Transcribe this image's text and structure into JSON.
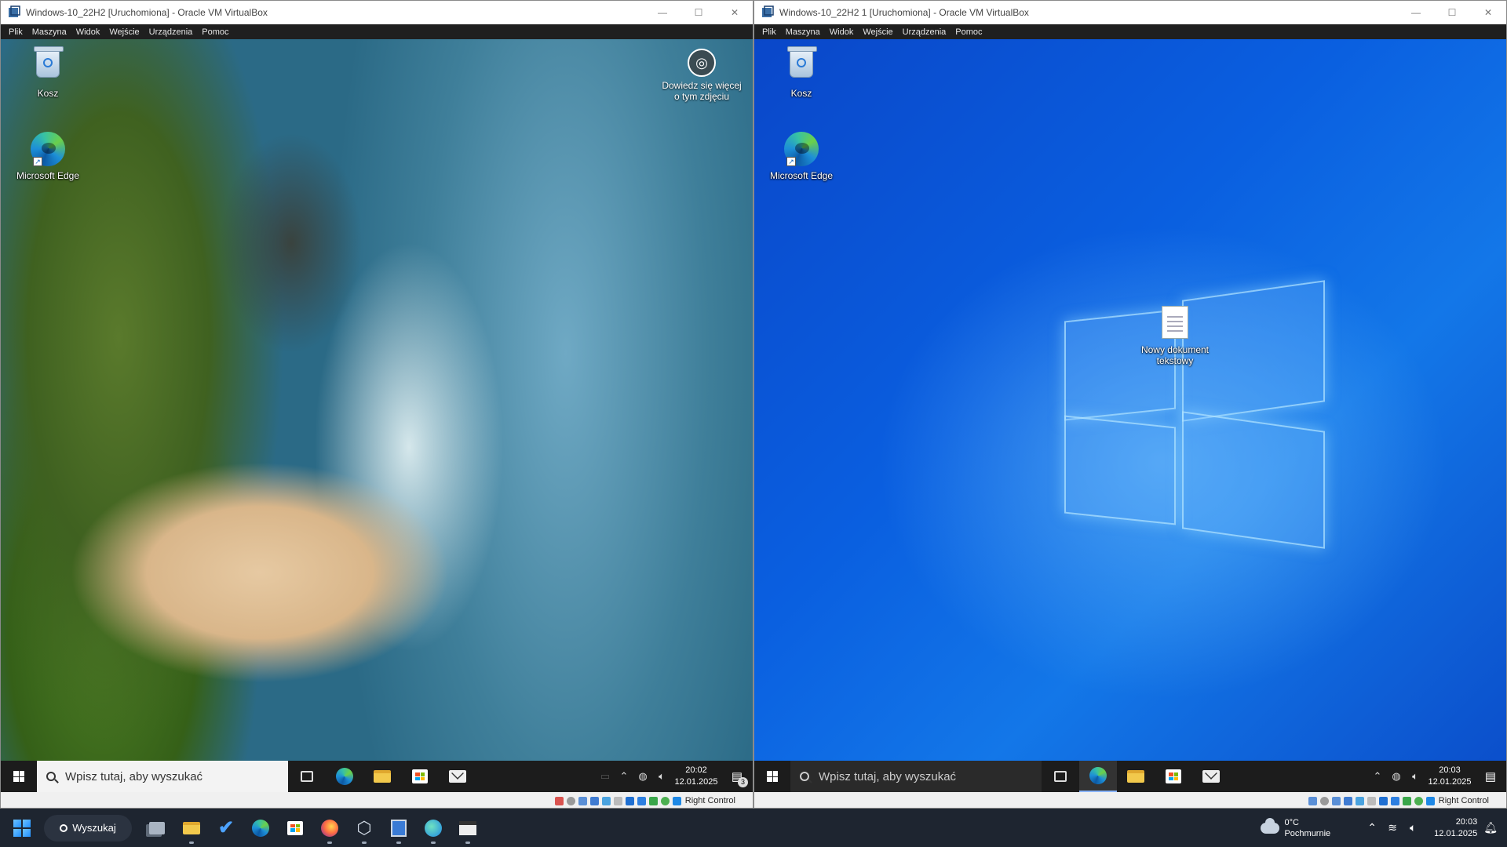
{
  "left_vm": {
    "title": "Windows-10_22H2 [Uruchomiona] - Oracle VM VirtualBox",
    "menu": [
      "Plik",
      "Maszyna",
      "Widok",
      "Wejście",
      "Urządzenia",
      "Pomoc"
    ],
    "desktop": {
      "recycle_bin": "Kosz",
      "edge": "Microsoft Edge",
      "learn_more": "Dowiedz się więcej o tym zdjęciu"
    },
    "taskbar": {
      "search_placeholder": "Wpisz tutaj, aby wyszukać",
      "time": "20:02",
      "date": "12.01.2025",
      "notification_count": "3"
    },
    "status_host_key": "Right Control"
  },
  "right_vm": {
    "title": "Windows-10_22H2 1 [Uruchomiona] - Oracle VM VirtualBox",
    "menu": [
      "Plik",
      "Maszyna",
      "Widok",
      "Wejście",
      "Urządzenia",
      "Pomoc"
    ],
    "desktop": {
      "recycle_bin": "Kosz",
      "edge": "Microsoft Edge",
      "text_doc": "Nowy dokument tekstowy"
    },
    "taskbar": {
      "search_placeholder": "Wpisz tutaj, aby wyszukać",
      "time": "20:03",
      "date": "12.01.2025"
    },
    "status_host_key": "Right Control"
  },
  "host_taskbar": {
    "search_label": "Wyszukaj",
    "weather_temp": "0°C",
    "weather_desc": "Pochmurnie",
    "time": "20:03",
    "date": "12.01.2025"
  },
  "colors": {
    "win10_blue": "#0a5fe0",
    "host_taskbar": "#1e2530",
    "guest_taskbar": "#1c1c1c"
  }
}
